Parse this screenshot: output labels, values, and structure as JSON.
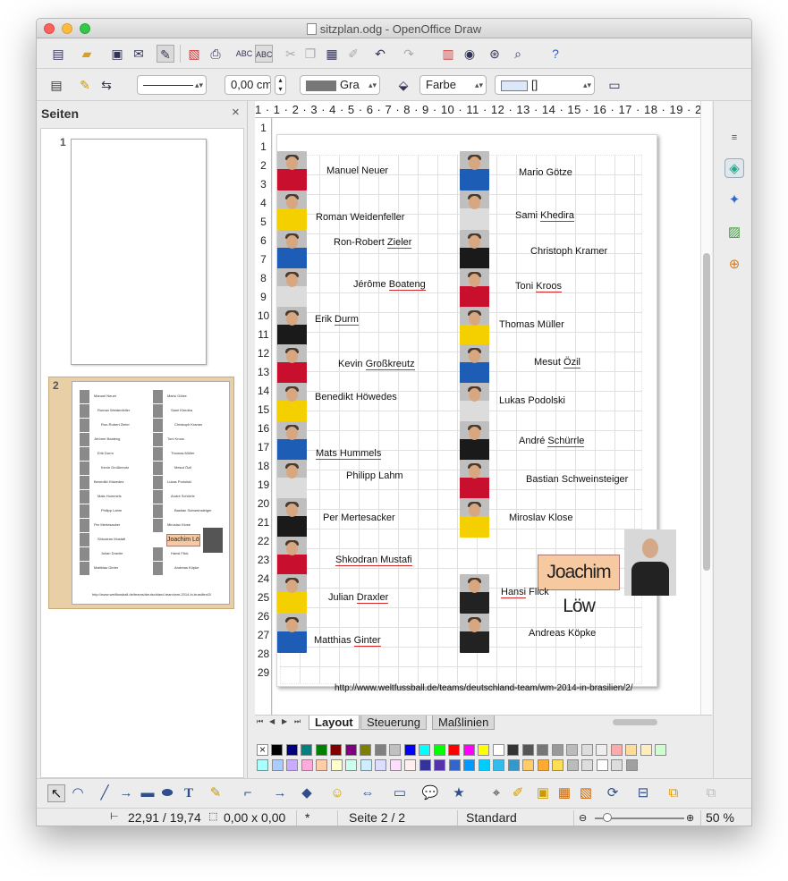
{
  "window": {
    "title": "sitzplan.odg - OpenOffice Draw"
  },
  "format_toolbar": {
    "line_width": "0,00 cm",
    "color_name": "Gra",
    "fill_type": "Farbe",
    "fill_value": "[]"
  },
  "pages_pane": {
    "title": "Seiten",
    "close": "×",
    "page1": "1",
    "page2": "2"
  },
  "ruler": {
    "h": "1 · 1 · 2 · 3 · 4 · 5 · 6 · 7 · 8 · 9 · 10 · 11 · 12 · 13 · 14 · 15 · 16 · 17 · 18 · 19 · 20 · 21 · 22",
    "v": [
      "1",
      "1",
      "2",
      "3",
      "4",
      "5",
      "6",
      "7",
      "8",
      "9",
      "10",
      "11",
      "12",
      "13",
      "14",
      "15",
      "16",
      "17",
      "18",
      "19",
      "20",
      "21",
      "22",
      "23",
      "24",
      "25",
      "26",
      "27",
      "28",
      "29"
    ]
  },
  "slide": {
    "left_names": [
      {
        "pre": "Manuel Neuer",
        "u": "",
        "post": ""
      },
      {
        "pre": "Roman Weidenfeller",
        "u": "",
        "post": ""
      },
      {
        "pre": "Ron-Robert ",
        "u": "Zieler",
        "post": ""
      },
      {
        "pre": "Jérôme ",
        "u": "Boateng",
        "post": ""
      },
      {
        "pre": "Erik ",
        "u": "Durm",
        "post": ""
      },
      {
        "pre": "Kevin ",
        "u": "Großkreutz",
        "post": ""
      },
      {
        "pre": "Benedikt Höwedes",
        "u": "",
        "post": ""
      },
      {
        "pre": "",
        "u": "Mats Hummels",
        "post": ""
      },
      {
        "pre": "Philipp Lahm",
        "u": "",
        "post": ""
      },
      {
        "pre": "Per Mertesacker",
        "u": "",
        "post": ""
      },
      {
        "pre": "",
        "u": "Shkodran Mustafi",
        "post": ""
      },
      {
        "pre": "Julian ",
        "u": "Draxler",
        "post": ""
      },
      {
        "pre": "Matthias ",
        "u": "Ginter",
        "post": ""
      }
    ],
    "right_names": [
      {
        "pre": "Mario Götze",
        "u": "",
        "post": ""
      },
      {
        "pre": "Sami ",
        "u": "Khedira",
        "post": ""
      },
      {
        "pre": "Christoph Kramer",
        "u": "",
        "post": ""
      },
      {
        "pre": "Toni ",
        "u": "Kroos",
        "post": ""
      },
      {
        "pre": "Thomas Müller",
        "u": "",
        "post": ""
      },
      {
        "pre": "Mesut ",
        "u": "Özil",
        "post": ""
      },
      {
        "pre": "Lukas Podolski",
        "u": "",
        "post": ""
      },
      {
        "pre": "André ",
        "u": "Schürrle",
        "post": ""
      },
      {
        "pre": "Bastian Schweinsteiger",
        "u": "",
        "post": ""
      },
      {
        "pre": "Miroslav Klose",
        "u": "",
        "post": ""
      },
      {
        "pre": "",
        "u": "Hansi",
        "post": " Flick"
      },
      {
        "pre": "Andreas Köpke",
        "u": "",
        "post": ""
      }
    ],
    "coach_label": "Joachim Löw",
    "url": "http://www.weltfussball.de/teams/deutschland-team/wm-2014-in-brasilien/2/"
  },
  "tabs": [
    {
      "label": "Layout",
      "active": true
    },
    {
      "label": "Steuerung",
      "active": false
    },
    {
      "label": "Maßlinien",
      "active": false
    }
  ],
  "palette": {
    "row1": [
      "#000000",
      "#000080",
      "#008080",
      "#008000",
      "#800000",
      "#800080",
      "#808000",
      "#808080",
      "#c0c0c0",
      "#0000ff",
      "#00ffff",
      "#00ff00",
      "#ff0000",
      "#ff00ff",
      "#ffff00",
      "#ffffff",
      "#333333",
      "#555555",
      "#777777",
      "#999999",
      "#bbbbbb",
      "#dddddd",
      "#eeeeee",
      "#ffaaaa",
      "#ffdd99",
      "#ffeebb",
      "#ccffcc"
    ],
    "row2": [
      "#aaffff",
      "#aaccff",
      "#ccaaff",
      "#ffaadd",
      "#ffccaa",
      "#ffffcc",
      "#ccffee",
      "#cceeff",
      "#ddddff",
      "#ffddff",
      "#ffeeee",
      "#333399",
      "#5533aa",
      "#3366cc",
      "#0099ff",
      "#00ccff",
      "#33bbee",
      "#3399cc",
      "#ffcc66",
      "#ffaa33",
      "#ffdd55",
      "#bbbbbb",
      "#dddddd",
      "#ffffff",
      "#dddddd",
      "#a0a0a0"
    ]
  },
  "status": {
    "position": "22,91 / 19,74",
    "size": "0,00 x 0,00",
    "modified": "*",
    "page": "Seite 2 / 2",
    "style": "Standard",
    "zoom": "50 %",
    "zoom_level": 0.14
  }
}
